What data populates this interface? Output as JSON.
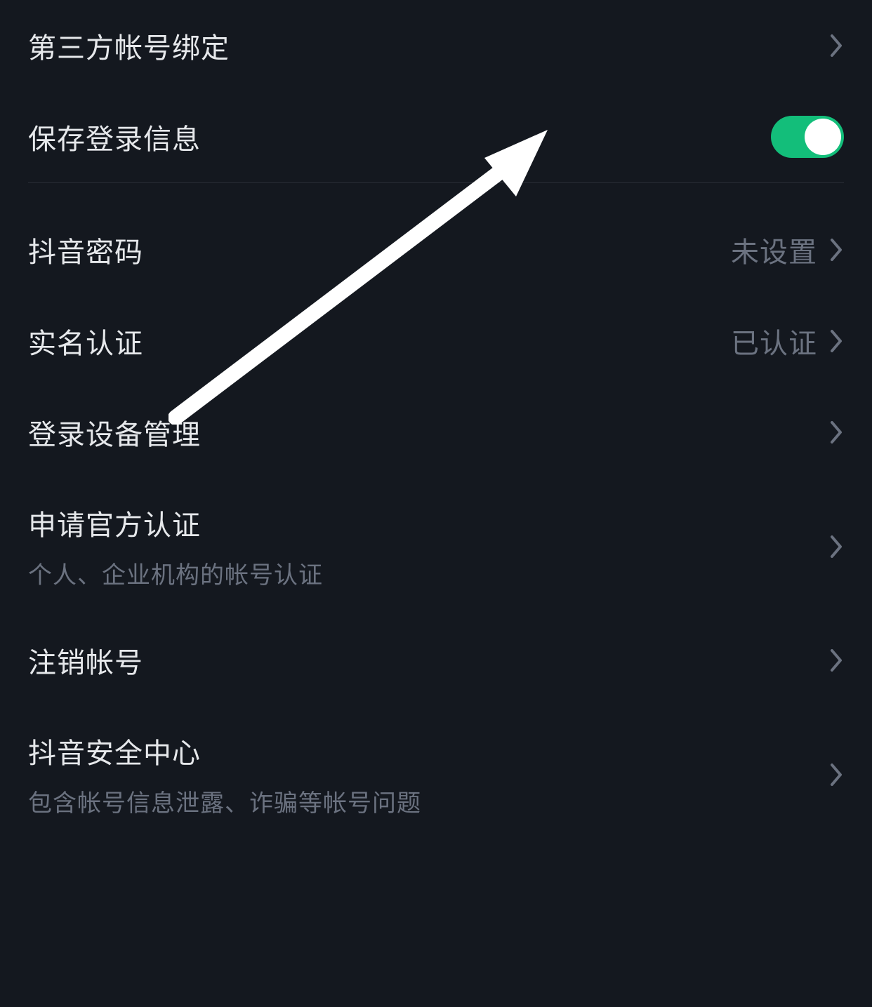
{
  "settings": {
    "third_party_binding": {
      "label": "第三方帐号绑定"
    },
    "save_login_info": {
      "label": "保存登录信息",
      "toggle_on": true
    },
    "douyin_password": {
      "label": "抖音密码",
      "value": "未设置"
    },
    "real_name_auth": {
      "label": "实名认证",
      "value": "已认证"
    },
    "login_device_management": {
      "label": "登录设备管理"
    },
    "official_verification": {
      "label": "申请官方认证",
      "subtitle": "个人、企业机构的帐号认证"
    },
    "delete_account": {
      "label": "注销帐号"
    },
    "security_center": {
      "label": "抖音安全中心",
      "subtitle": "包含帐号信息泄露、诈骗等帐号问题"
    }
  }
}
